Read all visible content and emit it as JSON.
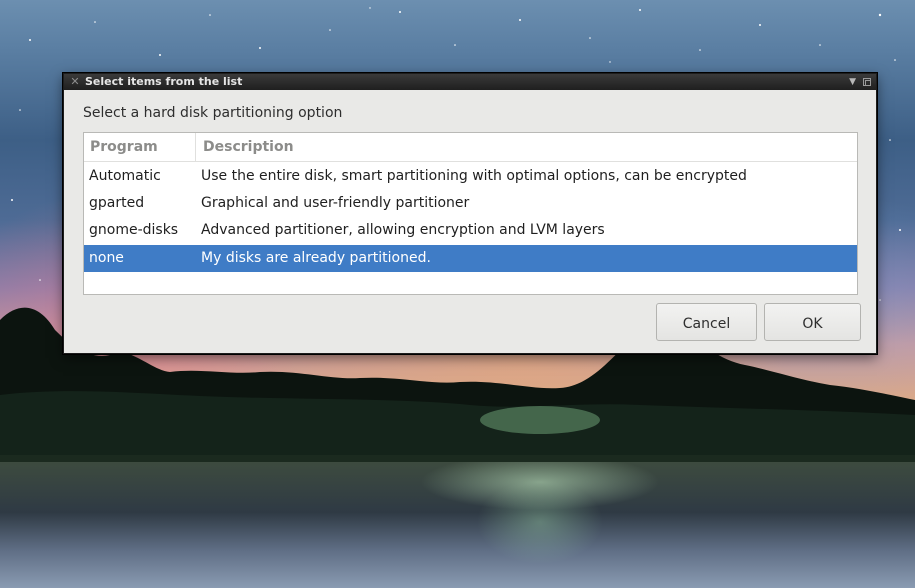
{
  "window": {
    "title": "Select items from the list",
    "close_glyph": "✕",
    "menu_glyph": "▼"
  },
  "dialog": {
    "prompt": "Select a hard disk partitioning option",
    "columns": [
      "Program",
      "Description"
    ],
    "rows": [
      {
        "program": "Automatic",
        "description": "Use the entire disk, smart partitioning with optimal options, can be encrypted",
        "selected": false
      },
      {
        "program": "gparted",
        "description": "Graphical and user-friendly partitioner",
        "selected": false
      },
      {
        "program": "gnome-disks",
        "description": "Advanced partitioner, allowing encryption and LVM layers",
        "selected": false
      },
      {
        "program": "none",
        "description": "My disks are already partitioned.",
        "selected": true
      }
    ],
    "buttons": {
      "cancel": "Cancel",
      "ok": "OK"
    }
  },
  "colors": {
    "selection": "#3f7cc6",
    "titlebar": "#2a2a2a",
    "dialog_bg": "#e9e9e7"
  }
}
